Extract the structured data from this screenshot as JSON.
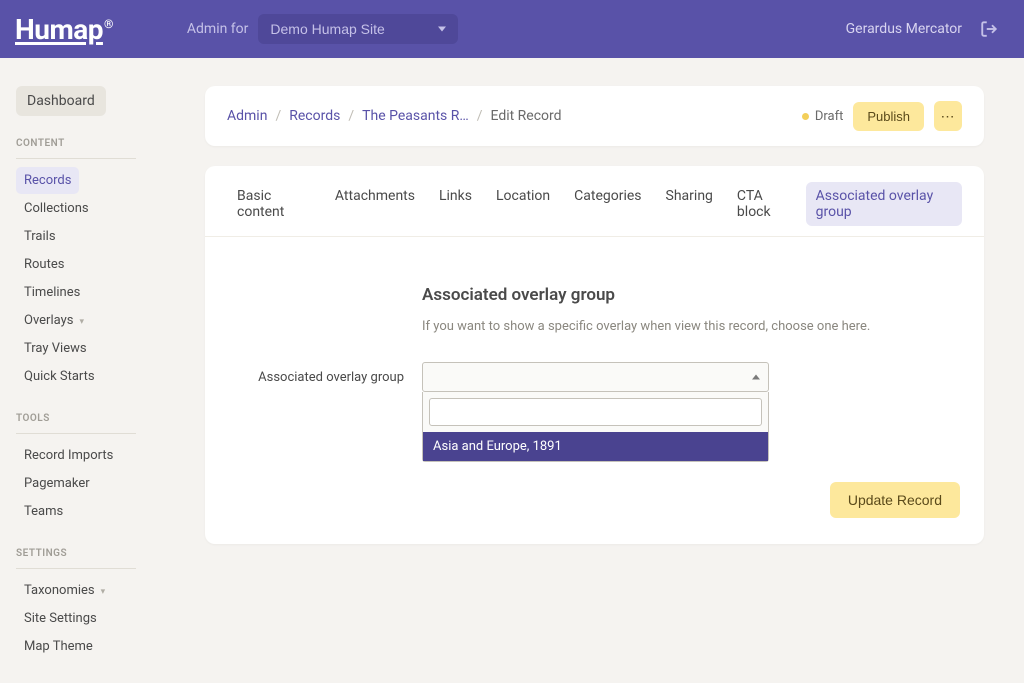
{
  "header": {
    "logo": "Humap",
    "admin_for": "Admin for",
    "site_name": "Demo Humap Site",
    "user_name": "Gerardus Mercator"
  },
  "sidebar": {
    "dashboard": "Dashboard",
    "sections": [
      {
        "title": "CONTENT",
        "items": [
          {
            "label": "Records",
            "active": true
          },
          {
            "label": "Collections"
          },
          {
            "label": "Trails"
          },
          {
            "label": "Routes"
          },
          {
            "label": "Timelines"
          },
          {
            "label": "Overlays",
            "chevron": true
          },
          {
            "label": "Tray Views"
          },
          {
            "label": "Quick Starts"
          }
        ]
      },
      {
        "title": "TOOLS",
        "items": [
          {
            "label": "Record Imports"
          },
          {
            "label": "Pagemaker"
          },
          {
            "label": "Teams"
          }
        ]
      },
      {
        "title": "SETTINGS",
        "items": [
          {
            "label": "Taxonomies",
            "chevron": true
          },
          {
            "label": "Site Settings"
          },
          {
            "label": "Map Theme"
          }
        ]
      }
    ]
  },
  "breadcrumb": {
    "items": [
      "Admin",
      "Records",
      "The Peasants R…"
    ],
    "current": "Edit Record",
    "status": "Draft",
    "publish": "Publish",
    "more": "⋯"
  },
  "tabs": [
    "Basic content",
    "Attachments",
    "Links",
    "Location",
    "Categories",
    "Sharing",
    "CTA block",
    "Associated overlay group"
  ],
  "form": {
    "section_title": "Associated overlay group",
    "section_desc": "If you want to show a specific overlay when view this record, choose one here.",
    "label": "Associated overlay group",
    "selected_option": "Asia and Europe, 1891",
    "search_value": ""
  },
  "actions": {
    "update": "Update Record"
  }
}
